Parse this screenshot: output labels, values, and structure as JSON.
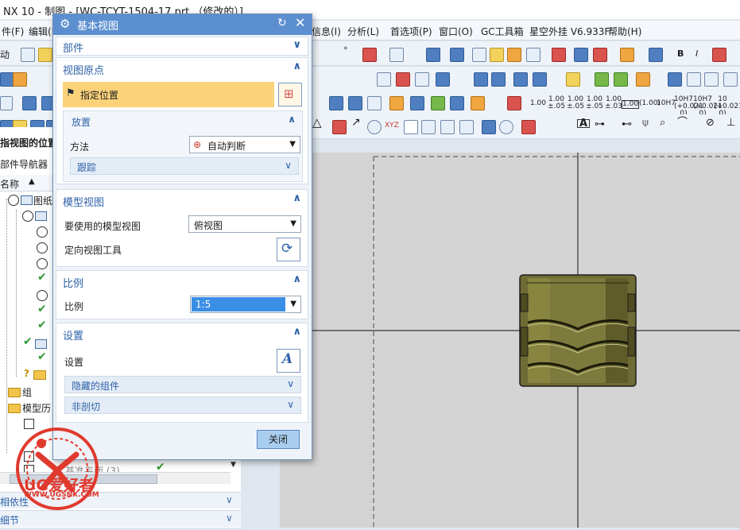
{
  "app": {
    "window_title": "NX 10 - 制图 - [WC-TCYT-1504-17.prt （修改的）]"
  },
  "menubar": {
    "items": [
      "件(F)",
      "编辑(E)",
      "信息(I)",
      "分析(L)",
      "首选项(P)",
      "窗口(O)",
      "GC工具箱",
      "星空外挂 V6.933F",
      "帮助(H)"
    ]
  },
  "toolbar": {
    "row1_label": "动",
    "row4_buttons": [
      "1.00",
      "1.00 ±.05",
      "1.00 ±.05",
      "1.00 ±.05",
      "1.00 ±.03",
      "1.00",
      "(1.00)",
      "10H7",
      "10H7 (+0.021 0)",
      "10H7 (+0.021 0)",
      "10 (+0.021 0)"
    ]
  },
  "left_nav": {
    "label_position": "指视图的位置",
    "label_navigator": "部件导航器",
    "col_name": "名称",
    "tree_root": "图纸",
    "tree_group": "组",
    "tree_history": "模型历",
    "tree_datum": "基准平面 (3)",
    "section_dependencies": "相依性",
    "section_details": "细节"
  },
  "dialog": {
    "title": "基本视图",
    "part_section": "部件",
    "view_origin": {
      "header": "视图原点",
      "specify_location": "指定位置",
      "placement_header": "放置",
      "method_label": "方法",
      "method_value": "自动判断",
      "tracking_label": "跟踪"
    },
    "model_view": {
      "header": "模型视图",
      "use_label": "要使用的模型视图",
      "use_value": "俯视图",
      "orient_label": "定向视图工具"
    },
    "scale": {
      "header": "比例",
      "label": "比例",
      "value": "1:5"
    },
    "settings": {
      "header": "设置",
      "label": "设置",
      "hidden_components": "隐藏的组件",
      "non_section": "非剖切"
    },
    "close_button": "关闭"
  },
  "watermark": {
    "brand": "UG爱好者",
    "url": "WWW.UGSNX.COM"
  }
}
